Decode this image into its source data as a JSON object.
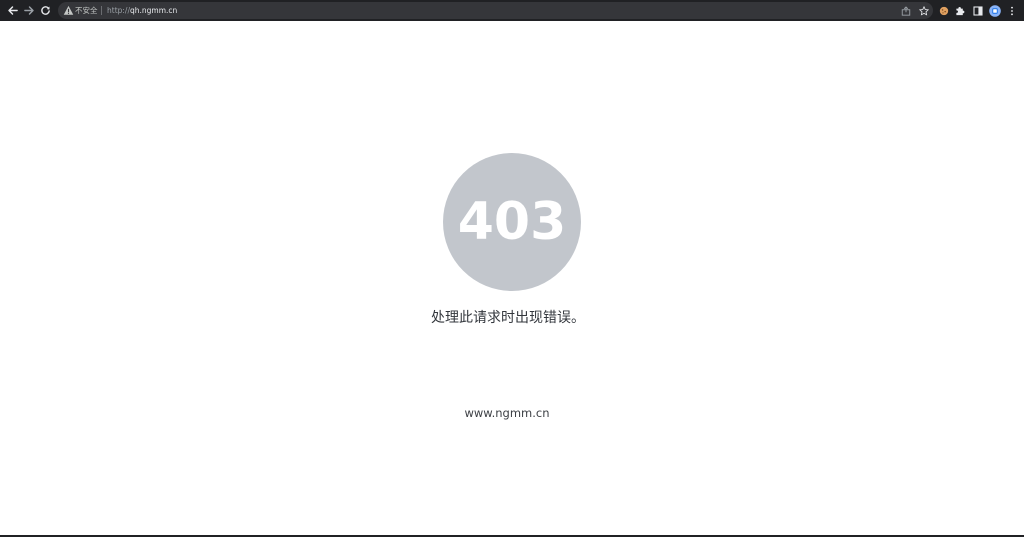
{
  "browser": {
    "security_label": "不安全",
    "url_scheme": "http://",
    "url_host": "qh.ngmm.cn",
    "icons": {
      "back": "back-arrow-icon",
      "forward": "forward-arrow-icon",
      "reload": "reload-icon",
      "warning": "warning-triangle-icon",
      "share": "share-icon",
      "bookmark": "star-icon",
      "extension_cookie": "cookie-extension-icon",
      "extensions": "puzzle-piece-icon",
      "side_panel": "side-panel-icon",
      "profile": "profile-avatar-icon",
      "menu": "kebab-menu-icon"
    },
    "colors": {
      "toolbar_bg": "#202124",
      "omnibox_bg": "#35363a",
      "profile_accent": "#8ab4f8"
    }
  },
  "page": {
    "error_code": "403",
    "message": "处理此请求时出现错误。",
    "domain": "www.ngmm.cn",
    "colors": {
      "circle": "#c2c6cc",
      "message_text": "#33373d"
    }
  }
}
